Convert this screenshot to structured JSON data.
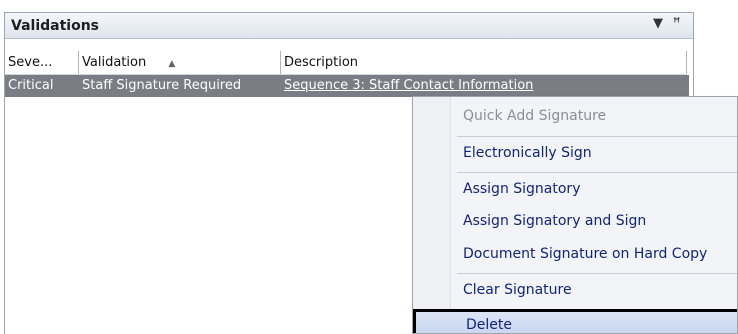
{
  "panel": {
    "title": "Validations",
    "dropdown_icon": "▼",
    "pin_icon": "ꟸ"
  },
  "grid": {
    "columns": [
      {
        "label": "Seve..."
      },
      {
        "label": "Validation",
        "sort": "▲"
      },
      {
        "label": "Description"
      }
    ],
    "rows": [
      {
        "severity": "Critical",
        "validation": "Staff Signature Required",
        "description": "Sequence 3: Staff Contact Information"
      }
    ]
  },
  "context_menu": {
    "items": [
      {
        "label": "Quick Add Signature"
      },
      {
        "label": "Electronically Sign"
      },
      {
        "label": "Assign Signatory"
      },
      {
        "label": "Assign Signatory and Sign"
      },
      {
        "label": "Document Signature on Hard Copy"
      },
      {
        "label": "Clear Signature"
      },
      {
        "label": "Delete"
      }
    ]
  },
  "colors": {
    "selected_row": "#7b7d85",
    "menu_text": "#10257a",
    "disabled_text": "#8c8f96"
  }
}
